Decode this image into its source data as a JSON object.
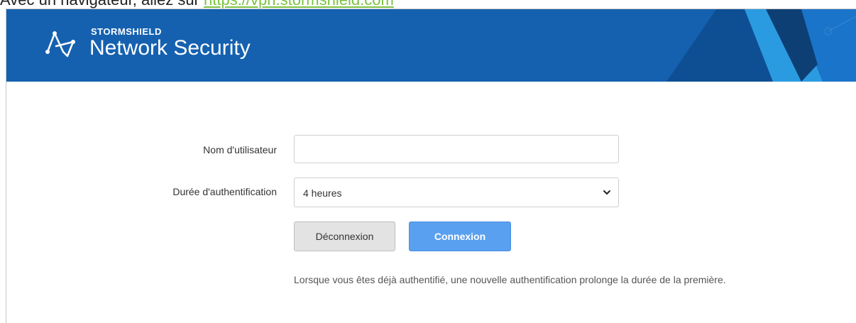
{
  "document": {
    "intro_text": "Avec un navigateur, allez sur ",
    "url": "https://vpn.stormshield.com"
  },
  "header": {
    "brand_top": "STORMSHIELD",
    "brand_main": "Network Security",
    "logo_icon": "stormshield-logo-icon",
    "background_color": "#1561b0"
  },
  "form": {
    "username_label": "Nom d'utilisateur",
    "username_value": "",
    "duration_label": "Durée d'authentification",
    "duration_selected": "4 heures",
    "logout_label": "Déconnexion",
    "login_label": "Connexion",
    "note": "Lorsque vous êtes déjà authentifié, une nouvelle authentification prolonge la durée de la première."
  },
  "colors": {
    "accent_link": "#7cc242",
    "login_button": "#5aa0f0",
    "logout_button": "#e3e3e3"
  }
}
